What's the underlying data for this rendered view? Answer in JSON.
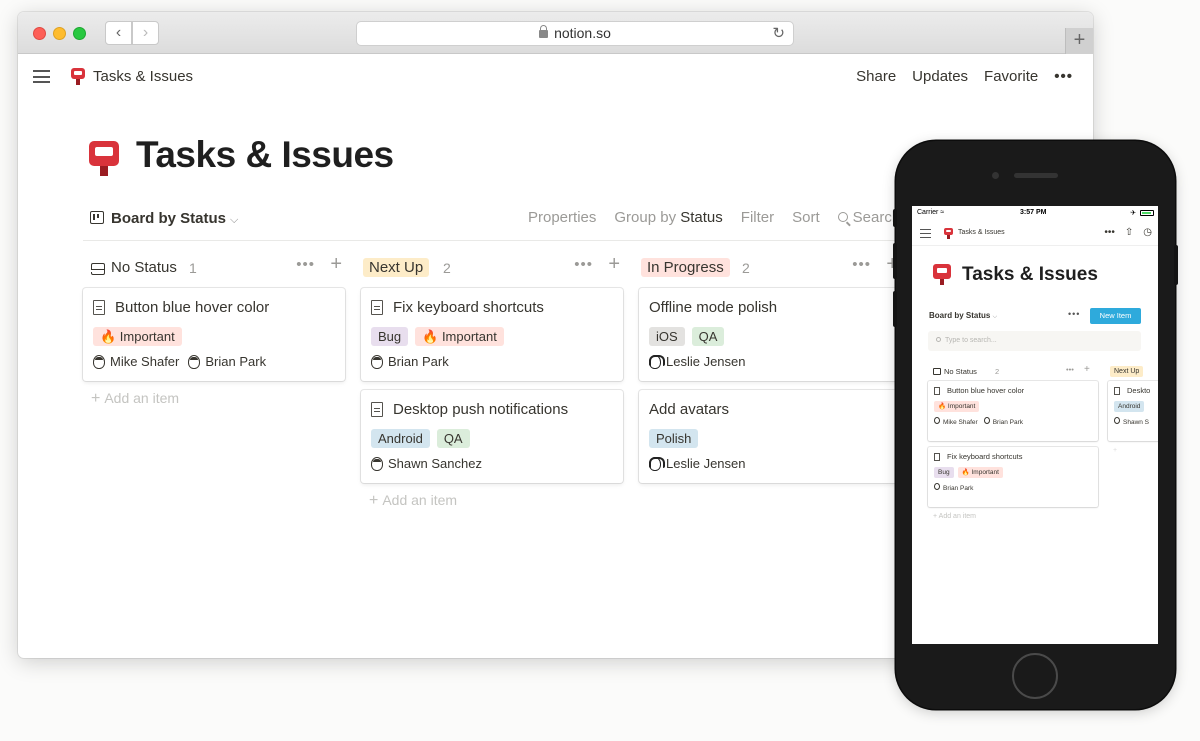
{
  "browser": {
    "url": "notion.so"
  },
  "topbar": {
    "breadcrumb": "Tasks & Issues",
    "share": "Share",
    "updates": "Updates",
    "favorite": "Favorite",
    "more": "•••"
  },
  "page": {
    "title": "Tasks & Issues"
  },
  "view": {
    "name": "Board by Status",
    "chevron": "⌵",
    "properties": "Properties",
    "group_by_label": "Group by",
    "group_by_value": "Status",
    "filter": "Filter",
    "sort": "Sort",
    "search": "Search"
  },
  "columns": [
    {
      "name": "No Status",
      "count": "1",
      "pill_color": "",
      "cards": [
        {
          "title": "Button blue hover color",
          "tags": [
            {
              "label": "🔥 Important",
              "color": "#ffe2dd"
            }
          ],
          "people": [
            {
              "name": "Mike Shafer",
              "icon": "face-icon"
            },
            {
              "name": "Brian Park",
              "icon": "face-icon"
            }
          ]
        }
      ],
      "add": "Add an item"
    },
    {
      "name": "Next Up",
      "count": "2",
      "pill_color": "#fdecc8",
      "cards": [
        {
          "title": "Fix keyboard shortcuts",
          "tags": [
            {
              "label": "Bug",
              "color": "#e8deee"
            },
            {
              "label": "🔥 Important",
              "color": "#ffe2dd"
            }
          ],
          "people": [
            {
              "name": "Brian Park",
              "icon": "face-icon"
            }
          ]
        },
        {
          "title": "Desktop push notifications",
          "tags": [
            {
              "label": "Android",
              "color": "#d3e5ef"
            },
            {
              "label": "QA",
              "color": "#dbeddb"
            }
          ],
          "people": [
            {
              "name": "Shawn Sanchez",
              "icon": "face-icon"
            }
          ]
        }
      ],
      "add": "Add an item"
    },
    {
      "name": "In Progress",
      "count": "2",
      "pill_color": "#ffe2dd",
      "cards": [
        {
          "title": "Offline mode polish",
          "tags": [
            {
              "label": "iOS",
              "color": "#e3e2e0"
            },
            {
              "label": "QA",
              "color": "#dbeddb"
            }
          ],
          "people": [
            {
              "name": "Leslie Jensen",
              "icon": "face-icon"
            }
          ]
        },
        {
          "title": "Add avatars",
          "tags": [
            {
              "label": "Polish",
              "color": "#d3e5ef"
            }
          ],
          "people": [
            {
              "name": "Leslie Jensen",
              "icon": "face-icon"
            }
          ]
        }
      ],
      "add": ""
    }
  ],
  "phone": {
    "carrier": "Carrier",
    "time": "3:57 PM",
    "breadcrumb": "Tasks & Issues",
    "title": "Tasks & Issues",
    "view_name": "Board by Status",
    "more": "•••",
    "new_item": "New Item",
    "search_placeholder": "Type to search...",
    "col1": {
      "name": "No Status",
      "count": "2",
      "card1_title": "Button blue hover color",
      "card1_tag": "🔥 Important",
      "card1_p1": "Mike Shafer",
      "card1_p2": "Brian Park",
      "card2_title": "Fix keyboard shortcuts",
      "card2_tag1": "Bug",
      "card2_tag2": "🔥 Important",
      "card2_p1": "Brian Park",
      "add": "Add an item"
    },
    "col2": {
      "name": "Next Up",
      "card_title": "Deskto",
      "tag": "Android",
      "person": "Shawn S"
    }
  }
}
